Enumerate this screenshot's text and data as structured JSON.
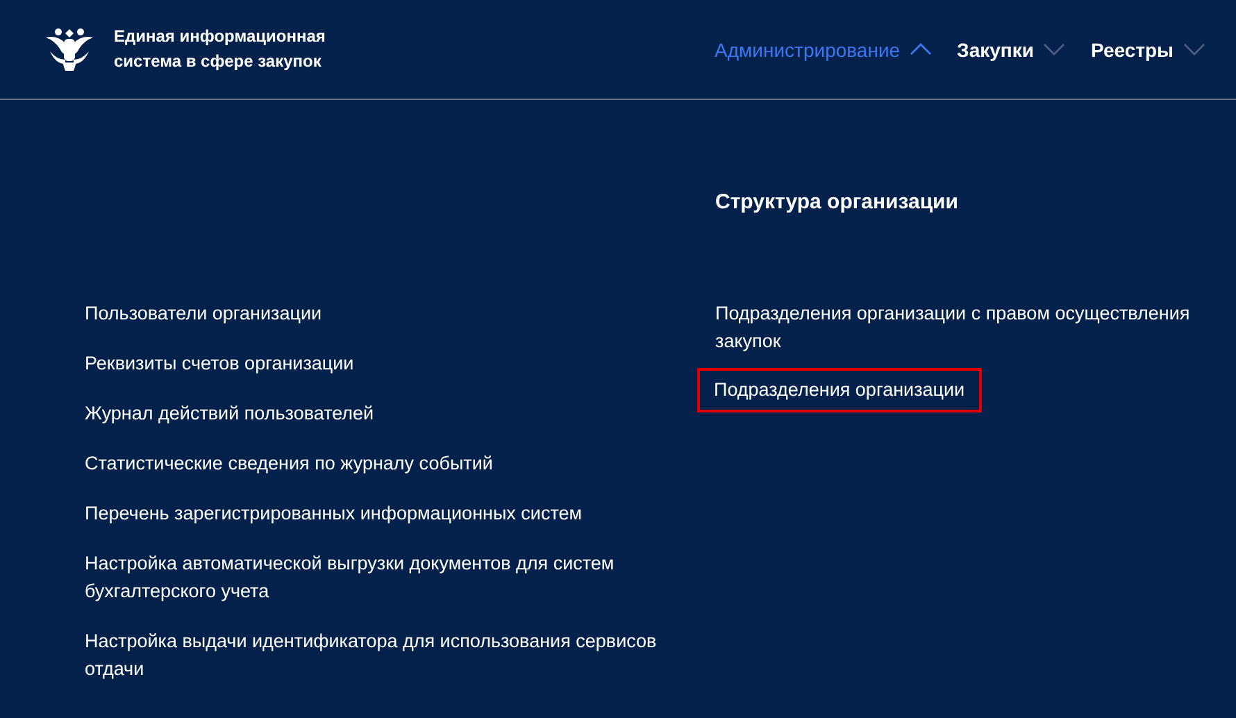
{
  "header": {
    "site_title": "Единая информационная система в сфере закупок",
    "nav": [
      {
        "label": "Администрирование",
        "expanded": true
      },
      {
        "label": "Закупки",
        "expanded": false
      },
      {
        "label": "Реестры",
        "expanded": false
      }
    ]
  },
  "menu": {
    "left_items": [
      {
        "label": "Пользователи организации",
        "highlighted": false
      },
      {
        "label": "Реквизиты счетов организации",
        "highlighted": false
      },
      {
        "label": "Журнал действий пользователей",
        "highlighted": false
      },
      {
        "label": "Статистические сведения по журналу событий",
        "highlighted": false
      },
      {
        "label": "Перечень зарегистрированных информационных систем",
        "highlighted": false
      },
      {
        "label": "Настройка автоматической выгрузки документов для систем бухгалтерского учета",
        "highlighted": false
      },
      {
        "label": "Настройка выдачи идентификатора для использования сервисов отдачи",
        "highlighted": false
      }
    ],
    "section": {
      "title": "Структура организации",
      "items": [
        {
          "label": "Подразделения организации с правом осуществления закупок",
          "highlighted": false
        },
        {
          "label": "Подразделения организации",
          "highlighted": true
        }
      ]
    }
  }
}
